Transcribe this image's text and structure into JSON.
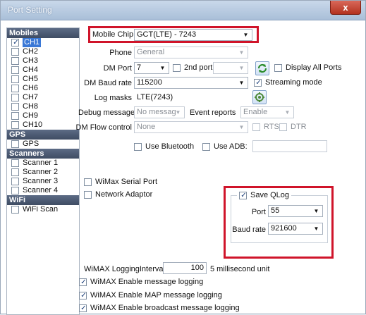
{
  "window": {
    "title": "Port Setting",
    "close_label": "x"
  },
  "sidebar": {
    "sections": [
      {
        "header": "Mobiles",
        "items": [
          {
            "label": "CH1",
            "checked": true,
            "selected": true
          },
          {
            "label": "CH2",
            "checked": false
          },
          {
            "label": "CH3",
            "checked": false
          },
          {
            "label": "CH4",
            "checked": false
          },
          {
            "label": "CH5",
            "checked": false
          },
          {
            "label": "CH6",
            "checked": false
          },
          {
            "label": "CH7",
            "checked": false
          },
          {
            "label": "CH8",
            "checked": false
          },
          {
            "label": "CH9",
            "checked": false
          },
          {
            "label": "CH10",
            "checked": false
          }
        ]
      },
      {
        "header": "GPS",
        "items": [
          {
            "label": "GPS",
            "checked": false
          }
        ]
      },
      {
        "header": "Scanners",
        "items": [
          {
            "label": "Scanner 1",
            "checked": false
          },
          {
            "label": "Scanner 2",
            "checked": false
          },
          {
            "label": "Scanner 3",
            "checked": false
          },
          {
            "label": "Scanner 4",
            "checked": false
          }
        ]
      },
      {
        "header": "WiFi",
        "items": [
          {
            "label": "WiFi Scan",
            "checked": false
          }
        ]
      }
    ]
  },
  "main": {
    "mobile_chip": {
      "label": "Mobile Chip",
      "value": "GCT(LTE) - 7243"
    },
    "phone": {
      "label": "Phone",
      "value": "General"
    },
    "dm_port": {
      "label": "DM Port",
      "value": "7",
      "second_port_label": "2nd port",
      "display_all_ports_label": "Display All Ports"
    },
    "dm_baud_rate": {
      "label": "DM Baud rate",
      "value": "115200",
      "streaming_mode_label": "Streaming mode",
      "streaming_mode_checked": true
    },
    "log_masks": {
      "label": "Log masks",
      "value": "LTE(7243)"
    },
    "debug_message": {
      "label": "Debug message",
      "value": "No messag",
      "event_reports_label": "Event reports",
      "event_reports_value": "Enable"
    },
    "dm_flow_control": {
      "label": "DM Flow control",
      "value": "None",
      "rts_label": "RTS",
      "dtr_label": "DTR"
    },
    "use_bluetooth_label": "Use Bluetooth",
    "use_adb_label": "Use ADB:",
    "wimax_serial_port_label": "WiMax Serial Port",
    "network_adaptor_label": "Network Adaptor",
    "qlog": {
      "save_label": "Save QLog",
      "save_checked": true,
      "port_label": "Port",
      "port_value": "55",
      "baud_label": "Baud rate",
      "baud_value": "921600"
    },
    "wimax_logging": {
      "label": "WiMAX LoggingInterval",
      "value": "100",
      "unit": "5 millisecond unit"
    },
    "wimax_options": [
      {
        "label": "WiMAX Enable message logging",
        "checked": true
      },
      {
        "label": "WiMAX Enable MAP message logging",
        "checked": true
      },
      {
        "label": "WiMAX Enable broadcast message logging",
        "checked": true
      }
    ]
  },
  "colors": {
    "highlight_box": "#d0142a",
    "selection": "#3a78d6",
    "sidebar_header": "#4a5770"
  }
}
